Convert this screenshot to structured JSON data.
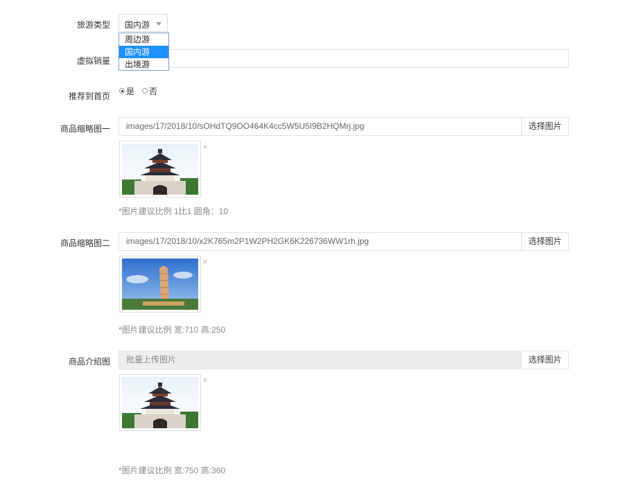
{
  "travel_type": {
    "label": "旅游类型",
    "selected": "国内游",
    "options": [
      "周边游",
      "国内游",
      "出境游"
    ]
  },
  "virtual_sales": {
    "label": "虚拟销量",
    "value": ""
  },
  "recommend": {
    "label": "推荐到首页",
    "yes_label": "是",
    "no_label": "否",
    "selected": "是"
  },
  "thumb1": {
    "label": "商品缩略图一",
    "path": "images/17/2018/10/sOHdTQ9OO464K4cc5W5U5I9B2HQMrj.jpg",
    "button": "选择图片",
    "remove": "×",
    "hint": "*图片建议比例 1比1 圆角：10"
  },
  "thumb2": {
    "label": "商品缩略图二",
    "path": "images/17/2018/10/x2K765m2P1W2PH2GK6K226736WW1rh.jpg",
    "button": "选择图片",
    "remove": "×",
    "hint": "*图片建议比例 宽:710 高:250"
  },
  "intro": {
    "label": "商品介绍图",
    "placeholder": "批量上传图片",
    "button": "选择图片",
    "remove": "×",
    "hint": "*图片建议比例 宽:750 高:360"
  },
  "colors": {
    "selected_option_bg": "#1e90ff",
    "border": "#e2e2e2",
    "disabled_bg": "#eeeeee",
    "hint_text": "#888888"
  }
}
